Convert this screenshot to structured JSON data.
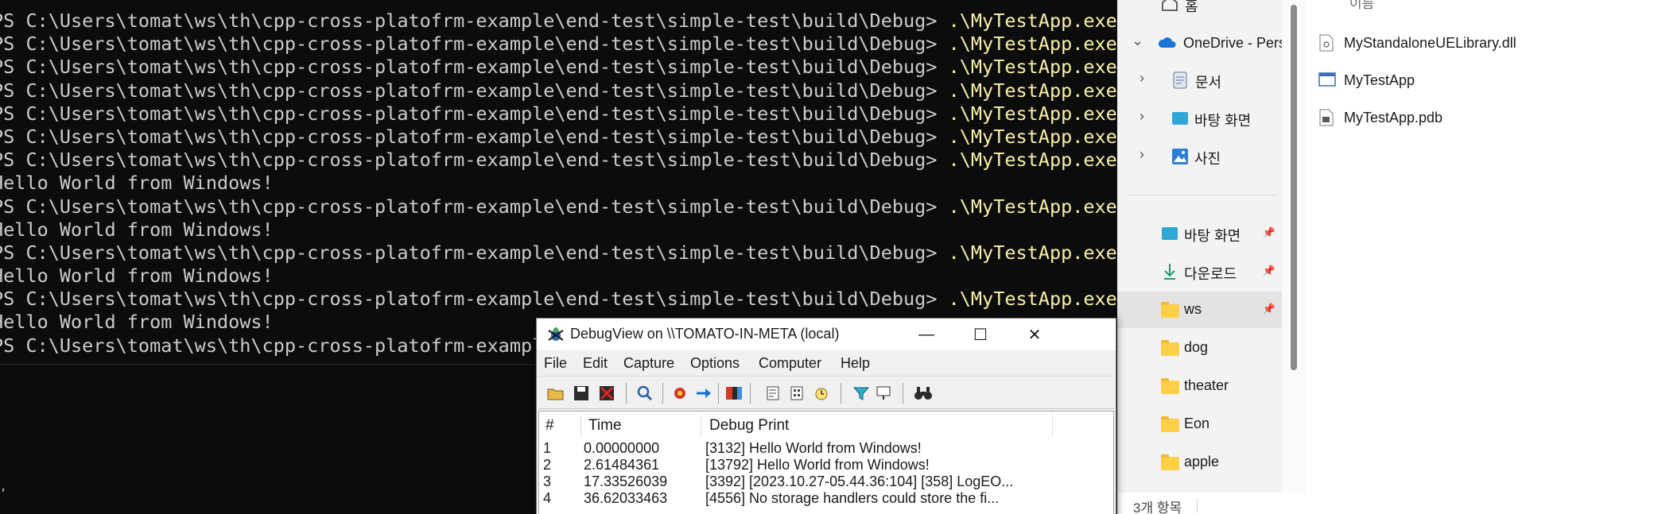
{
  "terminal": {
    "lines": [
      {
        "prompt": "PS C:\\Users\\tomat\\ws\\th\\cpp-cross-platofrm-example\\end-test\\simple-test\\build\\Debug> ",
        "cmd": ".\\MyTestApp.exe"
      },
      {
        "prompt": "PS C:\\Users\\tomat\\ws\\th\\cpp-cross-platofrm-example\\end-test\\simple-test\\build\\Debug> ",
        "cmd": ".\\MyTestApp.exe"
      },
      {
        "prompt": "PS C:\\Users\\tomat\\ws\\th\\cpp-cross-platofrm-example\\end-test\\simple-test\\build\\Debug> ",
        "cmd": ".\\MyTestApp.exe"
      },
      {
        "prompt": "PS C:\\Users\\tomat\\ws\\th\\cpp-cross-platofrm-example\\end-test\\simple-test\\build\\Debug> ",
        "cmd": ".\\MyTestApp.exe"
      },
      {
        "prompt": "PS C:\\Users\\tomat\\ws\\th\\cpp-cross-platofrm-example\\end-test\\simple-test\\build\\Debug> ",
        "cmd": ".\\MyTestApp.exe"
      },
      {
        "prompt": "PS C:\\Users\\tomat\\ws\\th\\cpp-cross-platofrm-example\\end-test\\simple-test\\build\\Debug> ",
        "cmd": ".\\MyTestApp.exe"
      },
      {
        "prompt": "PS C:\\Users\\tomat\\ws\\th\\cpp-cross-platofrm-example\\end-test\\simple-test\\build\\Debug> ",
        "cmd": ".\\MyTestApp.exe"
      },
      {
        "prompt": "Hello World from Windows!",
        "cmd": ""
      },
      {
        "prompt": "PS C:\\Users\\tomat\\ws\\th\\cpp-cross-platofrm-example\\end-test\\simple-test\\build\\Debug> ",
        "cmd": ".\\MyTestApp.exe"
      },
      {
        "prompt": "Hello World from Windows!",
        "cmd": ""
      },
      {
        "prompt": "PS C:\\Users\\tomat\\ws\\th\\cpp-cross-platofrm-example\\end-test\\simple-test\\build\\Debug> ",
        "cmd": ".\\MyTestApp.exe"
      },
      {
        "prompt": "Hello World from Windows!",
        "cmd": ""
      },
      {
        "prompt": "PS C:\\Users\\tomat\\ws\\th\\cpp-cross-platofrm-example\\end-test\\simple-test\\build\\Debug> ",
        "cmd": ".\\MyTestApp.exe"
      },
      {
        "prompt": "Hello World from Windows!",
        "cmd": ""
      },
      {
        "prompt": "PS C:\\Users\\tomat\\ws\\th\\cpp-cross-platofrm-example\\end-test\\simple-test\\build\\Debug> ",
        "cmd": ""
      }
    ],
    "colors": {
      "background": "#0c0c0c",
      "text": "#cccccc",
      "command": "#f9f1a5"
    }
  },
  "explorer": {
    "nav": {
      "home": "홈",
      "onedrive": "OneDrive - Pers",
      "documents": "문서",
      "desktop_cloud": "바탕 화면",
      "pictures": "사진",
      "desktop": "바탕 화면",
      "downloads": "다운로드",
      "ws": "ws",
      "dog": "dog",
      "theater": "theater",
      "eon": "Eon",
      "apple": "apple"
    },
    "column_header": "이름",
    "files": [
      "MyStandaloneUELibrary.dll",
      "MyTestApp",
      "MyTestApp.pdb"
    ],
    "status": "3개 항목"
  },
  "debugview": {
    "title": "DebugView on \\\\TOMATO-IN-META (local)",
    "menu": [
      "File",
      "Edit",
      "Capture",
      "Options",
      "Computer",
      "Help"
    ],
    "columns": {
      "num": "#",
      "time": "Time",
      "print": "Debug Print"
    },
    "rows": [
      {
        "num": "1",
        "time": "0.00000000",
        "print": "[3132] Hello World from Windows!"
      },
      {
        "num": "2",
        "time": "2.61484361",
        "print": "[13792] Hello World from Windows!"
      },
      {
        "num": "3",
        "time": "17.33526039",
        "print": "[3392] [2023.10.27-05.44.36:104] [358] LogEO..."
      },
      {
        "num": "4",
        "time": "36.62033463",
        "print": "[4556] No storage handlers could store the fi..."
      }
    ]
  }
}
